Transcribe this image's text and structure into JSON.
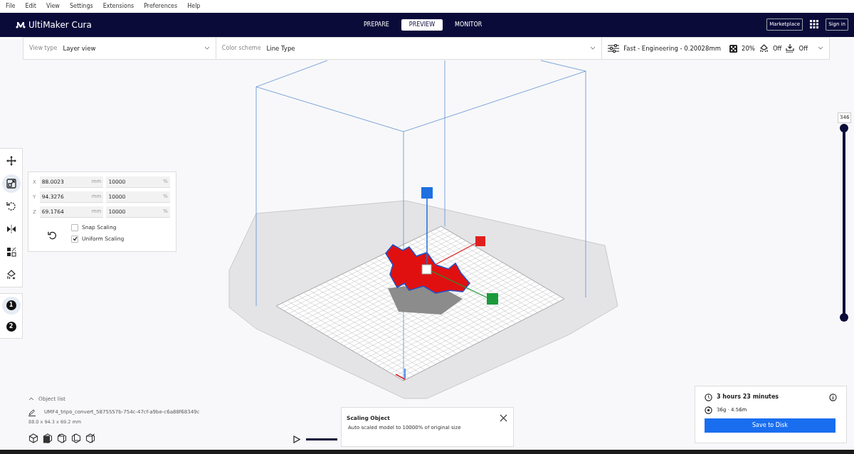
{
  "menu": [
    "File",
    "Edit",
    "View",
    "Settings",
    "Extensions",
    "Preferences",
    "Help"
  ],
  "app_title": "UltiMaker Cura",
  "stages": [
    {
      "label": "PREPARE",
      "selected": false
    },
    {
      "label": "PREVIEW",
      "selected": true
    },
    {
      "label": "MONITOR",
      "selected": false
    }
  ],
  "header_buttons": {
    "marketplace": "Marketplace",
    "sign_in": "Sign in"
  },
  "toolbar": {
    "view_type": {
      "label": "View type",
      "value": "Layer view"
    },
    "color_scheme": {
      "label": "Color scheme",
      "value": "Line Type"
    },
    "print_settings": {
      "profile": "Fast - Engineering - 0.20028mm",
      "infill": "20%",
      "support": "Off",
      "adhesion": "Off"
    }
  },
  "tools": [
    {
      "kind": "move",
      "selected": false
    },
    {
      "kind": "scale",
      "selected": true
    },
    {
      "kind": "rotate",
      "selected": false
    },
    {
      "kind": "mirror",
      "selected": false
    },
    {
      "kind": "per-model",
      "selected": false
    },
    {
      "kind": "support-blocker",
      "selected": false
    }
  ],
  "extruders": [
    {
      "label": "1",
      "selected": true
    },
    {
      "label": "2",
      "selected": false
    }
  ],
  "scale_panel": {
    "rows": [
      {
        "axis": "X",
        "value": "88.0023",
        "unit": "mm",
        "percent": "10000",
        "percent_unit": "%"
      },
      {
        "axis": "Y",
        "value": "94.3276",
        "unit": "mm",
        "percent": "10000",
        "percent_unit": "%"
      },
      {
        "axis": "Z",
        "value": "69.1764",
        "unit": "mm",
        "percent": "10000",
        "percent_unit": "%"
      }
    ],
    "options": [
      {
        "label": "Snap Scaling",
        "checked": false
      },
      {
        "label": "Uniform Scaling",
        "checked": true
      }
    ]
  },
  "layer_slider": {
    "label": "346",
    "level": 1
  },
  "object_list": {
    "title": "Object list",
    "expanded": true,
    "file": "UMF4_tripo_convert_5875557b-754c-47cf-a9be-c6a88f68349c",
    "dimensions": "88.0 x 94.3 x 69.2 mm"
  },
  "camera_views": [
    {
      "kind": "iso"
    },
    {
      "kind": "front"
    },
    {
      "kind": "top"
    },
    {
      "kind": "left"
    },
    {
      "kind": "right"
    }
  ],
  "playback": {
    "level": 1
  },
  "toast": {
    "title": "Scaling Object",
    "message": "Auto scaled model to 10000% of original size"
  },
  "print_info": {
    "time": "3 hours 23 minutes",
    "material": "36g · 4.56m",
    "button": "Save to Disk"
  }
}
